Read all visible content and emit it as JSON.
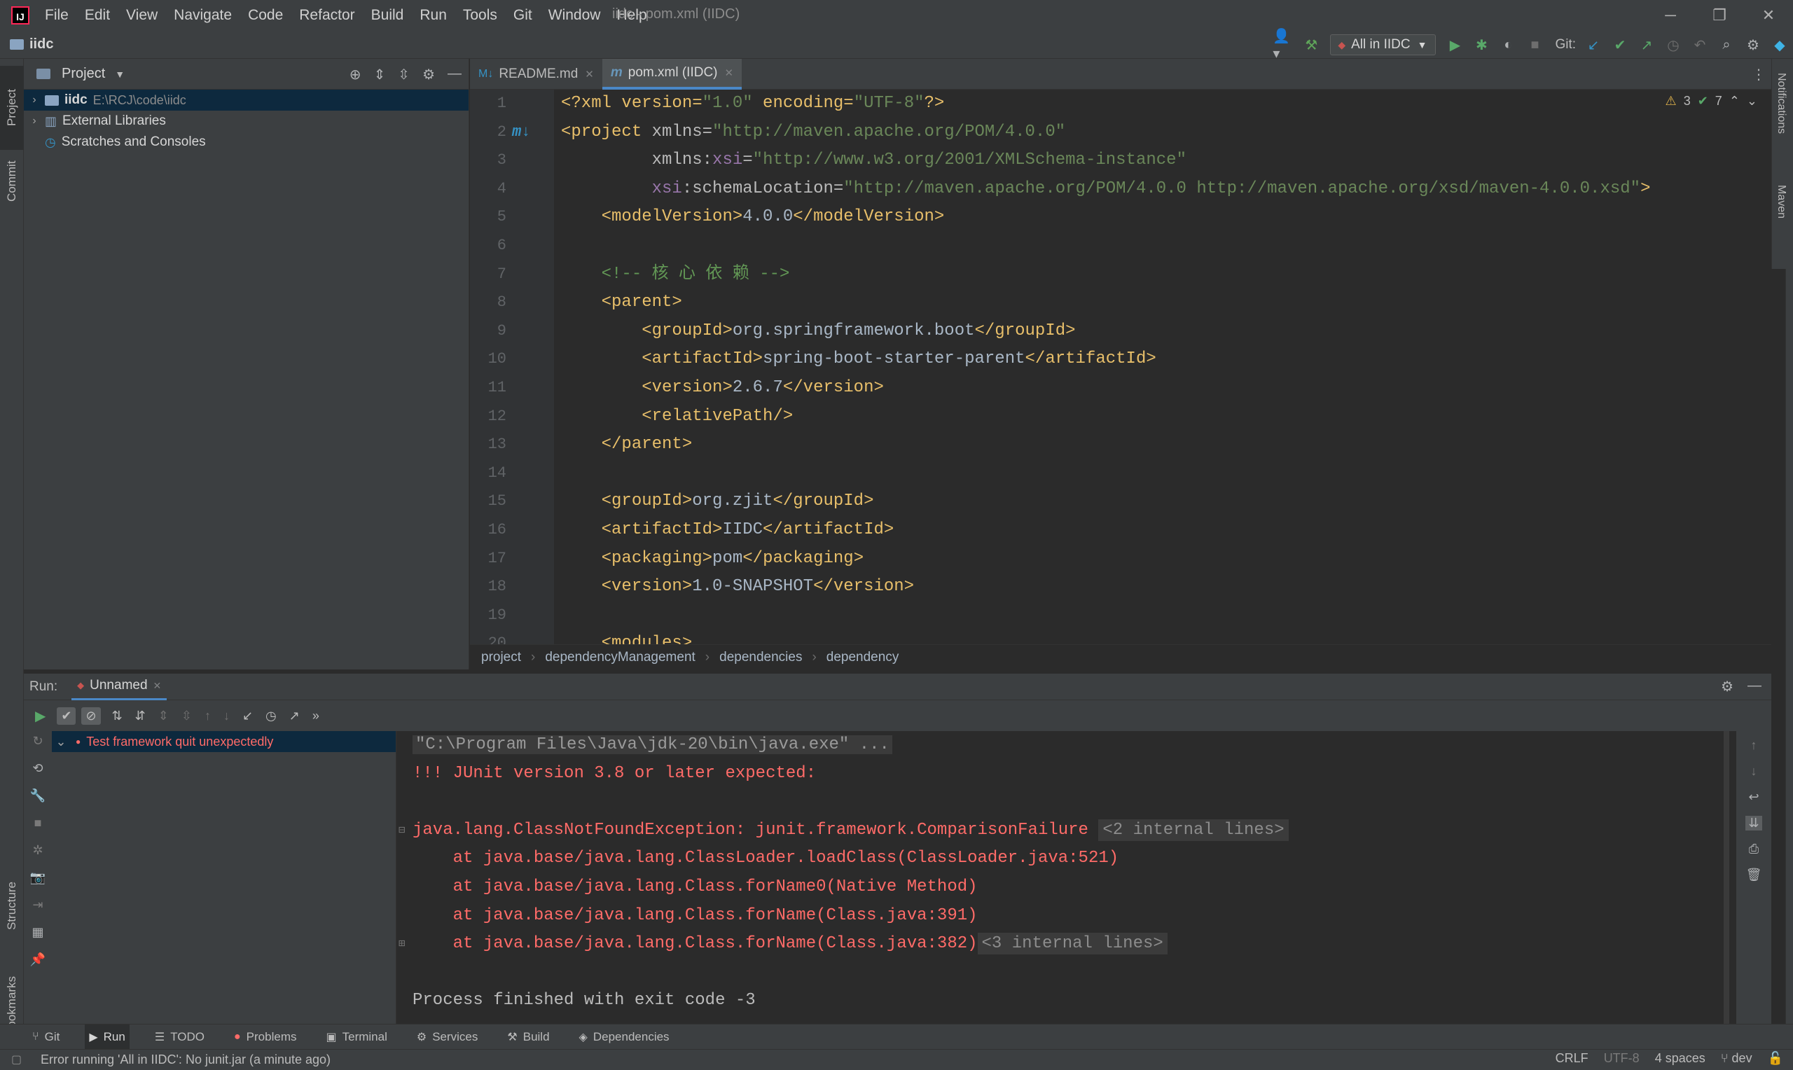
{
  "window": {
    "title": "iidc - pom.xml (IIDC)",
    "menus": [
      "File",
      "Edit",
      "View",
      "Navigate",
      "Code",
      "Refactor",
      "Build",
      "Run",
      "Tools",
      "Git",
      "Window",
      "Help"
    ],
    "logo_text": "IJ"
  },
  "navbar": {
    "project_name": "iidc",
    "run_config": "All in IIDC",
    "git_label": "Git:"
  },
  "left_stripe": {
    "tabs": [
      "Project",
      "Commit",
      "Structure",
      "Bookmarks"
    ]
  },
  "right_stripe": {
    "tabs": [
      "Notifications",
      "Maven"
    ]
  },
  "project_panel": {
    "title": "Project",
    "tree": [
      {
        "name": "iidc",
        "path": "E:\\RCJ\\code\\iidc"
      },
      {
        "name": "External Libraries"
      },
      {
        "name": "Scratches and Consoles"
      }
    ]
  },
  "editor": {
    "tabs": [
      {
        "label": "README.md"
      },
      {
        "label": "pom.xml (IIDC)"
      }
    ],
    "inspections": {
      "warnings": "3",
      "ok": "7"
    },
    "line_numbers": [
      "1",
      "2",
      "3",
      "4",
      "5",
      "6",
      "7",
      "8",
      "9",
      "10",
      "11",
      "12",
      "13",
      "14",
      "15",
      "16",
      "17",
      "18",
      "19",
      "20"
    ],
    "lines": {
      "l1_a": "<?xml version=",
      "l1_b": "\"1.0\"",
      "l1_c": " encoding=",
      "l1_d": "\"UTF-8\"",
      "l1_e": "?>",
      "l2_a": "<project",
      "l2_b": " xmlns=",
      "l2_c": "\"http://maven.apache.org/POM/4.0.0\"",
      "l3_a": "         xmlns:",
      "l3_b": "xsi",
      "l3_c": "=",
      "l3_d": "\"http://www.w3.org/2001/XMLSchema-instance\"",
      "l4_a": "         ",
      "l4_b": "xsi",
      "l4_c": ":schemaLocation=",
      "l4_d": "\"http://maven.apache.org/POM/4.0.0 http://maven.apache.org/xsd/maven-4.0.0.xsd\"",
      "l4_e": ">",
      "l5_a": "    <modelVersion>",
      "l5_b": "4.0.0",
      "l5_c": "</modelVersion>",
      "l7": "    <!-- 核 心 依 赖 -->",
      "l8": "    <parent>",
      "l9_a": "        <groupId>",
      "l9_b": "org.springframework.boot",
      "l9_c": "</groupId>",
      "l10_a": "        <artifactId>",
      "l10_b": "spring-boot-starter-parent",
      "l10_c": "</artifactId>",
      "l11_a": "        <version>",
      "l11_b": "2.6.7",
      "l11_c": "</version>",
      "l12": "        <relativePath/>",
      "l13": "    </parent>",
      "l15_a": "    <groupId>",
      "l15_b": "org.zjit",
      "l15_c": "</groupId>",
      "l16_a": "    <artifactId>",
      "l16_b": "IIDC",
      "l16_c": "</artifactId>",
      "l17_a": "    <packaging>",
      "l17_b": "pom",
      "l17_c": "</packaging>",
      "l18_a": "    <version>",
      "l18_b": "1.0-SNAPSHOT",
      "l18_c": "</version>",
      "l20": "    <modules>"
    },
    "breadcrumb": [
      "project",
      "dependencyManagement",
      "dependencies",
      "dependency"
    ]
  },
  "run_panel": {
    "label": "Run:",
    "tab": "Unnamed",
    "test_item": "Test framework quit unexpectedly",
    "console": {
      "cmd": "\"C:\\Program Files\\Java\\jdk-20\\bin\\java.exe\" ...",
      "line2": "!!! JUnit version 3.8 or later expected:",
      "exc": "java.lang.ClassNotFoundException: junit.framework.ComparisonFailure",
      "exc_fold": "<2 internal lines>",
      "st1": "    at java.base/java.lang.ClassLoader.loadClass(ClassLoader.java:521)",
      "st2": "    at java.base/java.lang.Class.forName0(Native Method)",
      "st3": "    at java.base/java.lang.Class.forName(Class.java:391)",
      "st4": "    at java.base/java.lang.Class.forName(Class.java:382)",
      "st4_fold": "<3 internal lines>",
      "exit": "Process finished with exit code -3"
    }
  },
  "bottom_tools": [
    "Git",
    "Run",
    "TODO",
    "Problems",
    "Terminal",
    "Services",
    "Build",
    "Dependencies"
  ],
  "status": {
    "message": "Error running 'All in IIDC': No junit.jar (a minute ago)",
    "line_sep": "CRLF",
    "encoding": "UTF-8",
    "indent": "4 spaces",
    "branch": "dev"
  }
}
